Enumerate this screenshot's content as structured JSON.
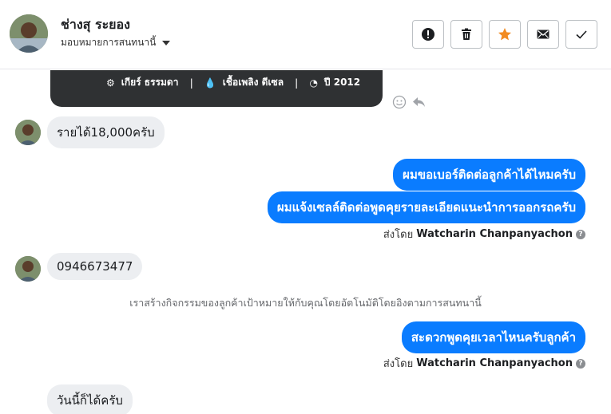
{
  "header": {
    "contact_name": "ช่างสุ ระยอง",
    "assign_label": "มอบหมายการสนทนานี้",
    "colors": {
      "star": "#f28b21",
      "border": "#bcc0c4"
    },
    "buttons": [
      {
        "name": "alert-button",
        "icon": "exclamation-icon"
      },
      {
        "name": "delete-button",
        "icon": "trash-icon"
      },
      {
        "name": "star-button",
        "icon": "star-icon"
      },
      {
        "name": "mail-button",
        "icon": "envelope-icon"
      },
      {
        "name": "done-button",
        "icon": "check-icon"
      }
    ]
  },
  "card": {
    "gear": "เกียร์ ธรรมดา",
    "fuel": "เชื้อเพลิง ดีเซล",
    "year": "ปี 2012"
  },
  "messages": {
    "in_1": "รายได้18,000ครับ",
    "out_1": "ผมขอเบอร์ติดต่อลูกค้าได้ไหมครับ",
    "out_2": "ผมแจ้งเซลล์ติดต่อพูดคุยรายละเอียดแนะนำการออกรถครับ",
    "sent_by_1_prefix": "ส่งโดย",
    "sent_by_1_name": "Watcharin Chanpanyachon",
    "in_2": "0946673477",
    "system_note": "เราสร้างกิจกรรมของลูกค้าเป้าหมายให้กับคุณโดยอัตโนมัติโดยอิงตามการสนทนานี้",
    "out_3": "สะดวกพูดคุยเวลาไหนครับลูกค้า",
    "sent_by_2_prefix": "ส่งโดย",
    "sent_by_2_name": "Watcharin Chanpanyachon",
    "in_3": "วันนี้ก็ได้ครับ"
  },
  "colors": {
    "outgoing_bubble": "#0a7cff",
    "incoming_bubble": "#eceef1",
    "card_background": "#2f3133"
  }
}
